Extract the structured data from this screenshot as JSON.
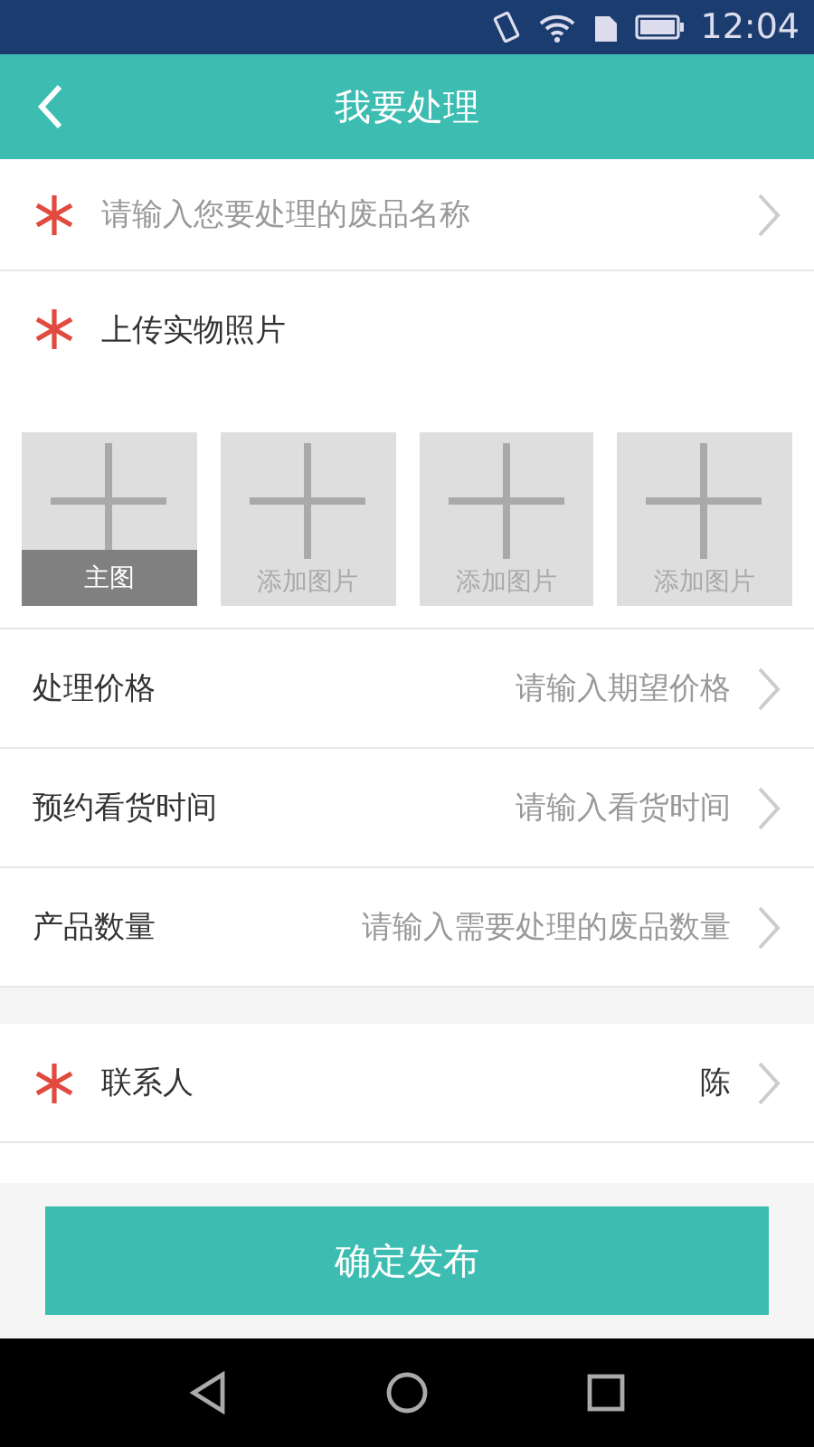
{
  "status_bar": {
    "time": "12:04"
  },
  "header": {
    "title": "我要处理"
  },
  "name_field": {
    "required": true,
    "placeholder": "请输入您要处理的废品名称"
  },
  "upload": {
    "required": true,
    "label": "上传实物照片",
    "tiles": [
      {
        "kind": "main",
        "badge": "主图"
      },
      {
        "kind": "add",
        "label": "添加图片"
      },
      {
        "kind": "add",
        "label": "添加图片"
      },
      {
        "kind": "add",
        "label": "添加图片"
      }
    ]
  },
  "details": [
    {
      "label": "处理价格",
      "placeholder": "请输入期望价格"
    },
    {
      "label": "预约看货时间",
      "placeholder": "请输入看货时间"
    },
    {
      "label": "产品数量",
      "placeholder": "请输入需要处理的废品数量"
    }
  ],
  "contact": [
    {
      "required": true,
      "label": "联系人",
      "value": "陈"
    }
  ],
  "submit": "确定发布"
}
